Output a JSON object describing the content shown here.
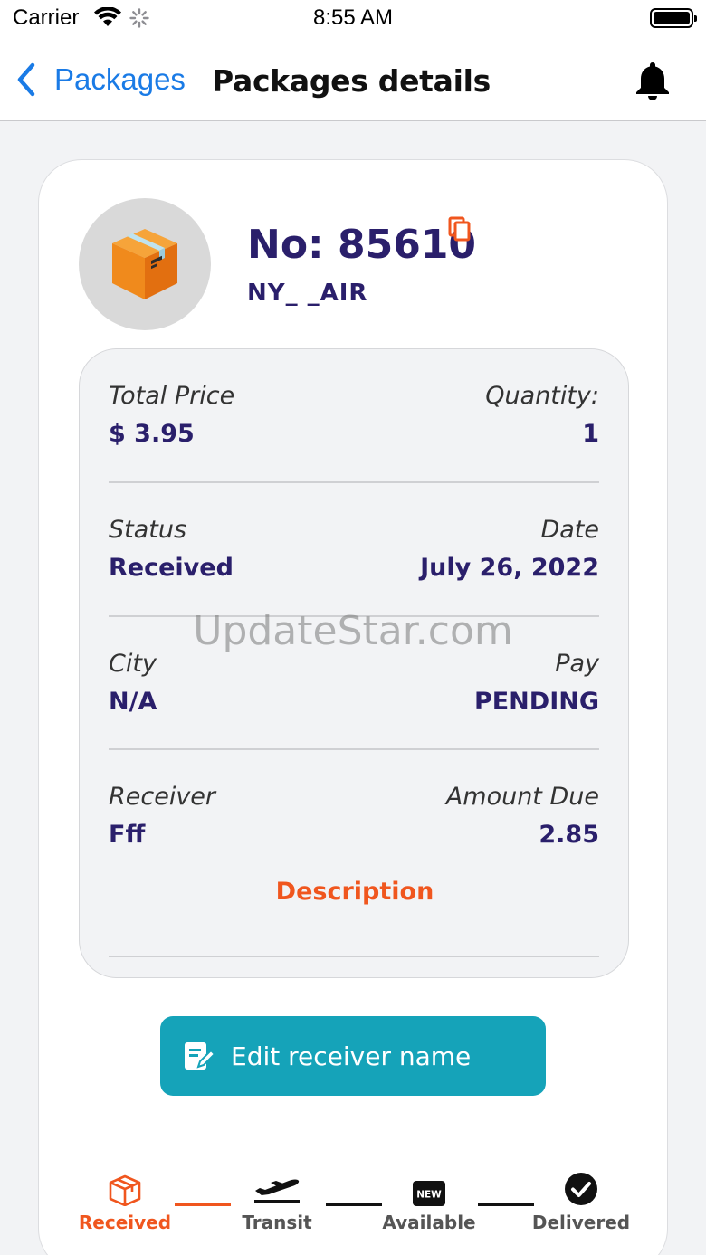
{
  "status_bar": {
    "carrier": "Carrier",
    "time": "8:55 AM"
  },
  "nav": {
    "back_label": "Packages",
    "title": "Packages details"
  },
  "package": {
    "number": "No: 85610",
    "route": "NY_ _AIR"
  },
  "details": {
    "total_price_label": "Total Price",
    "total_price_value": "$ 3.95",
    "quantity_label": "Quantity:",
    "quantity_value": "1",
    "status_label": "Status",
    "status_value": "Received",
    "date_label": "Date",
    "date_value": "July 26, 2022",
    "city_label": "City",
    "city_value": "N/A",
    "pay_label": "Pay",
    "pay_value": "PENDING",
    "receiver_label": "Receiver",
    "receiver_value": "Fff",
    "amount_due_label": "Amount Due",
    "amount_due_value": "2.85",
    "description_title": "Description"
  },
  "edit_button": {
    "label": "Edit receiver name"
  },
  "stepper": {
    "steps": [
      {
        "label": "Received",
        "icon": "box-icon",
        "active": true
      },
      {
        "label": "Transit",
        "icon": "plane-takeoff-icon",
        "active": false
      },
      {
        "label": "Available",
        "icon": "new-badge-icon",
        "active": false
      },
      {
        "label": "Delivered",
        "icon": "check-circle-icon",
        "active": false
      }
    ]
  },
  "watermark": "UpdateStar.com",
  "colors": {
    "primary": "#2a1f6b",
    "accent": "#f0561e",
    "teal": "#15a3b9",
    "ios_blue": "#1a7be6"
  }
}
